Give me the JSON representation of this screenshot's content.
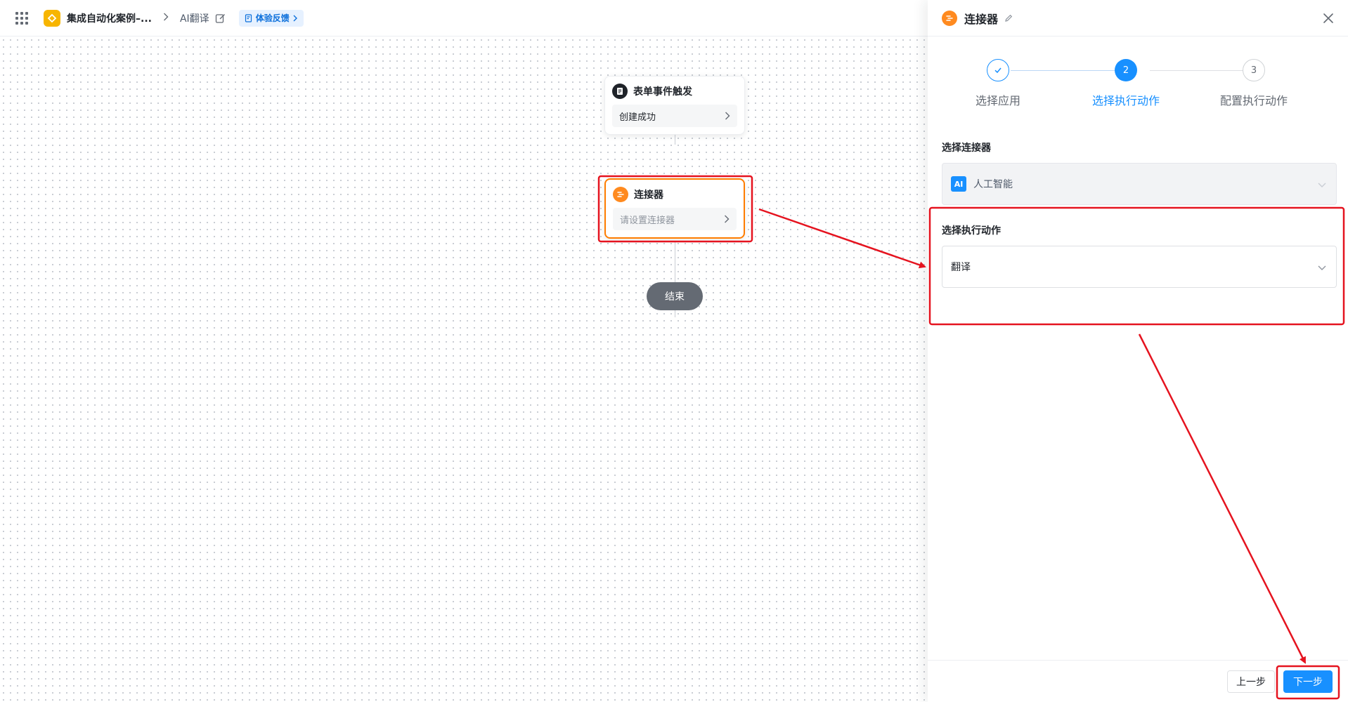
{
  "topbar": {
    "app_name": "集成自动化案例–...",
    "flow_name": "AI翻译",
    "feedback_label": "体验反馈"
  },
  "canvas": {
    "trigger_node": {
      "title": "表单事件触发",
      "value": "创建成功"
    },
    "connector_node": {
      "title": "连接器",
      "placeholder": "请设置连接器"
    },
    "end_label": "结束"
  },
  "panel": {
    "title": "连接器",
    "steps": [
      {
        "index": "1",
        "label": "选择应用",
        "state": "done"
      },
      {
        "index": "2",
        "label": "选择执行动作",
        "state": "active"
      },
      {
        "index": "3",
        "label": "配置执行动作",
        "state": "todo"
      }
    ],
    "connector_field": {
      "label": "选择连接器",
      "badge": "AI",
      "value": "人工智能"
    },
    "action_field": {
      "label": "选择执行动作",
      "value": "翻译"
    },
    "footer": {
      "prev_label": "上一步",
      "next_label": "下一步"
    }
  },
  "colors": {
    "accent": "#1890ff",
    "connector_orange": "#ff7d00",
    "annotation_red": "#e5131f",
    "app_logo_yellow": "#f7b500"
  }
}
